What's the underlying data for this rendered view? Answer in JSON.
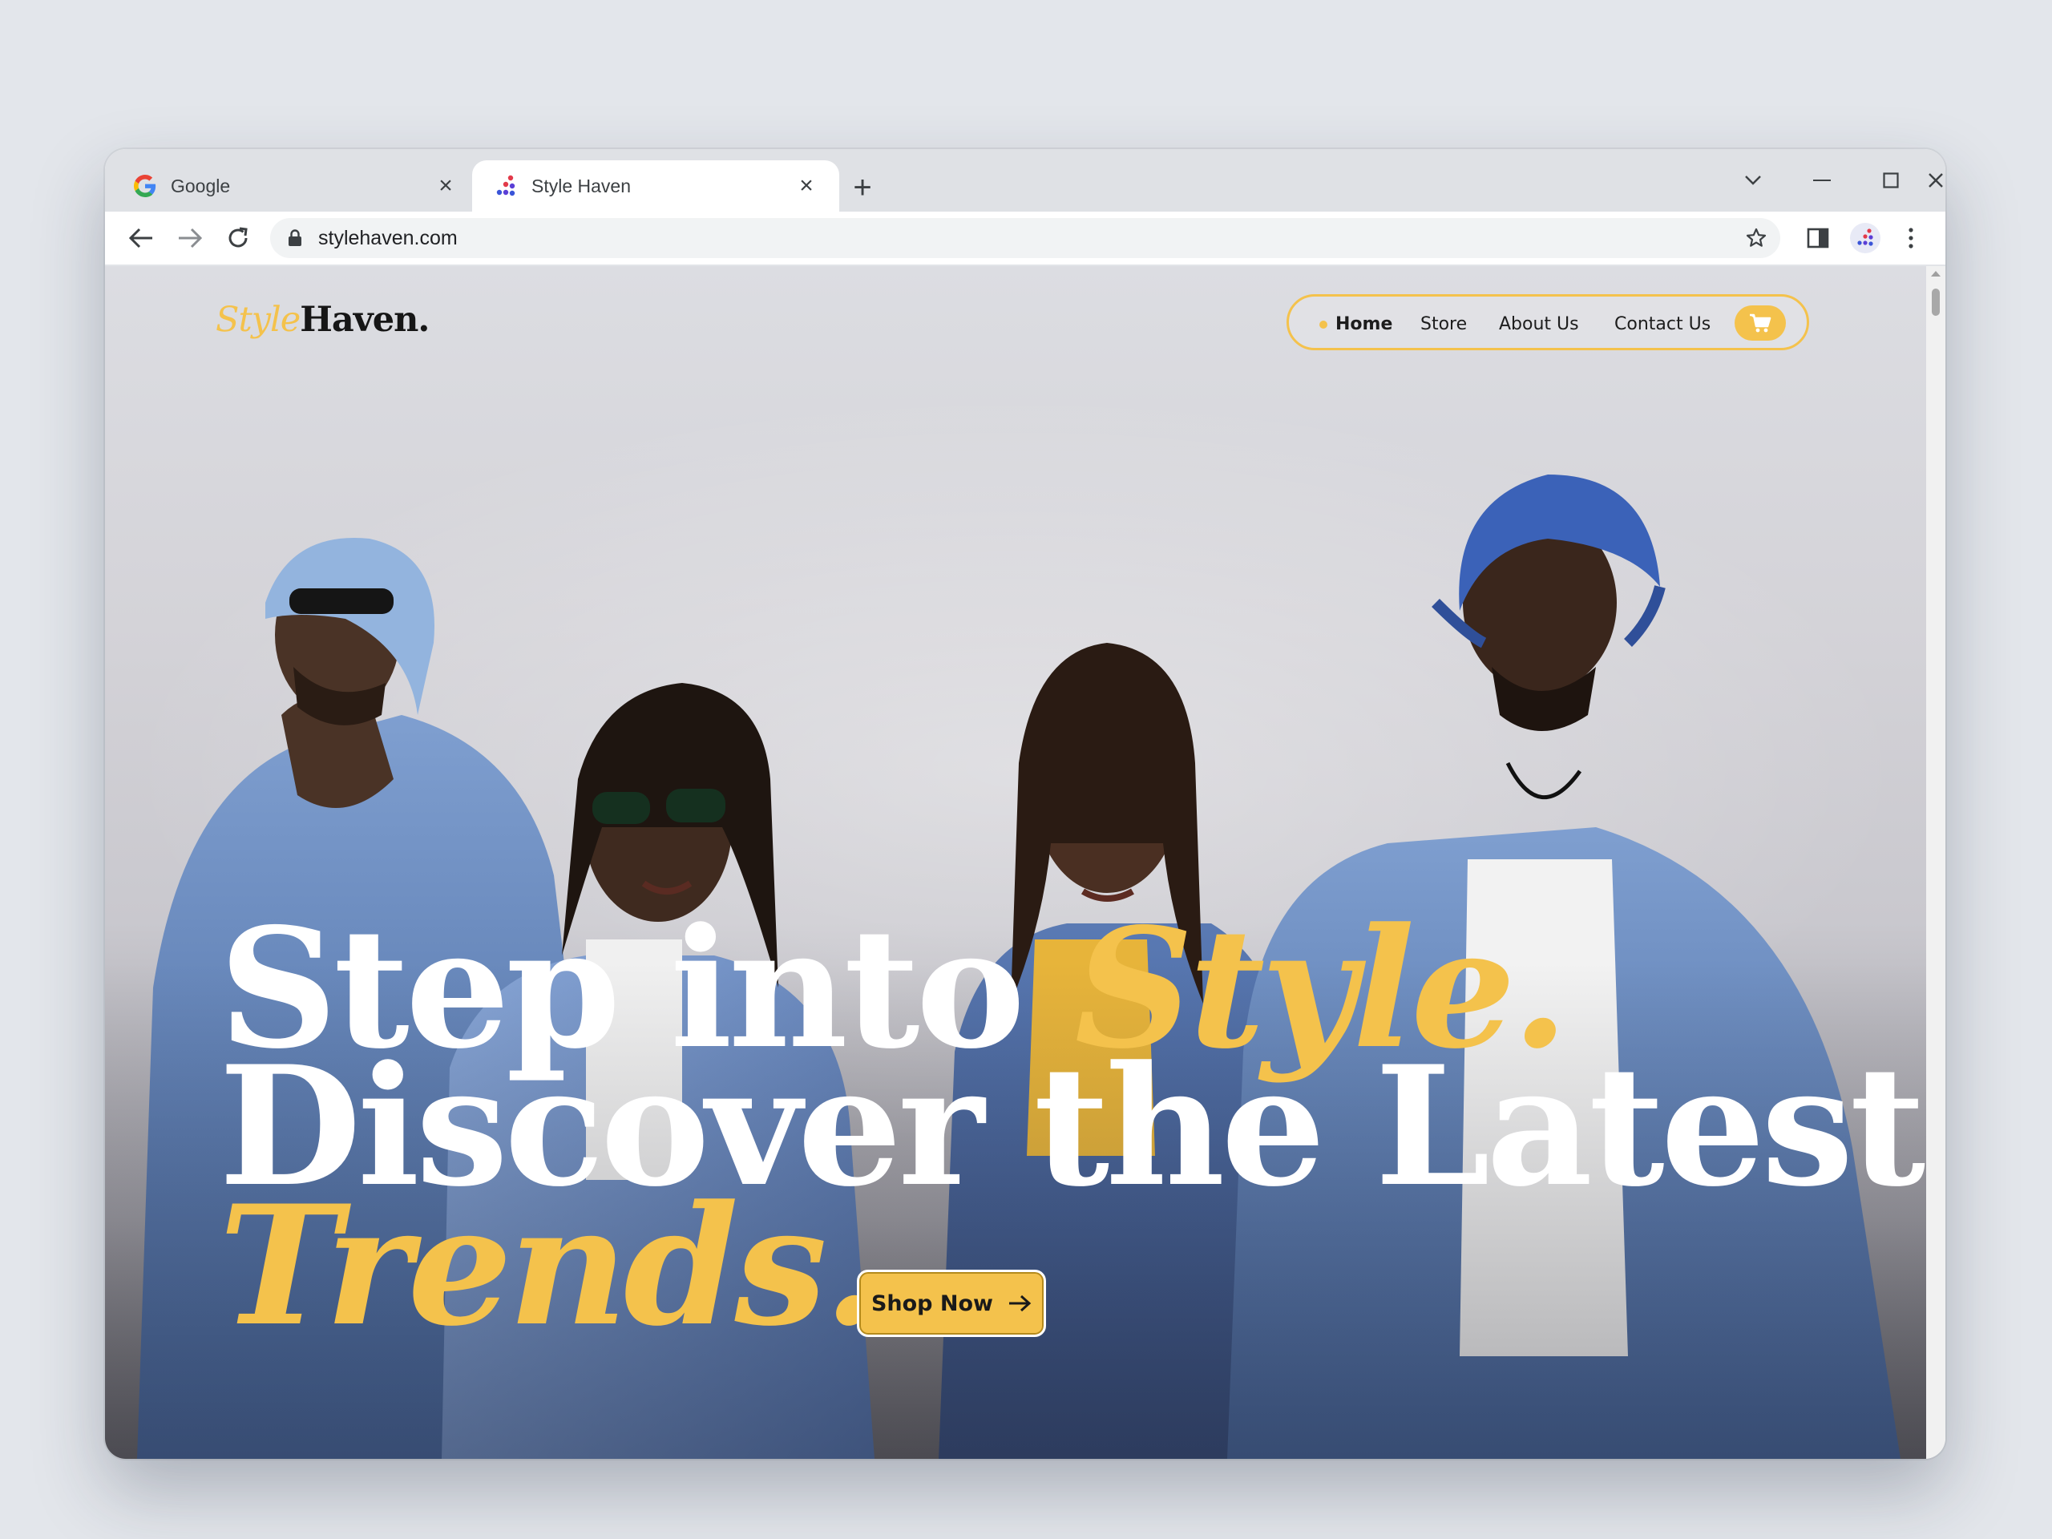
{
  "browser": {
    "tabs": [
      {
        "title": "Google",
        "icon": "google-g-icon",
        "active": false
      },
      {
        "title": "Style Haven",
        "icon": "style-haven-dots-icon",
        "active": true
      }
    ],
    "url": "stylehaven.com"
  },
  "site": {
    "logo": {
      "part1": "Style",
      "part2": "Haven."
    },
    "nav": {
      "items": [
        "Home",
        "Store",
        "About Us",
        "Contact Us"
      ],
      "active": "Home"
    },
    "hero": {
      "line1_white": "Step into ",
      "line1_gold": "Style.",
      "line2": "Discover the Latest",
      "line3_gold": "Trends."
    },
    "cta": "Shop Now"
  },
  "colors": {
    "accent": "#f4c24c",
    "text_dark": "#161616",
    "denim": "#5d7fb8"
  }
}
